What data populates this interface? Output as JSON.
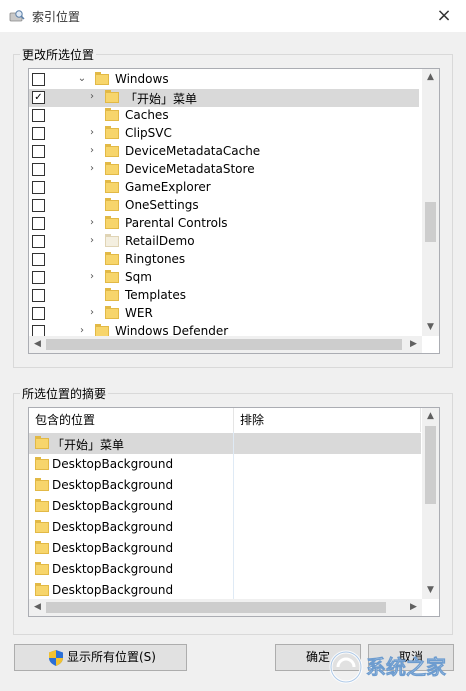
{
  "window": {
    "title": "索引位置",
    "close_icon": "×",
    "app_icon": "search-index-icon"
  },
  "change_group": {
    "legend": "更改所选位置",
    "tree": [
      {
        "label": "Windows",
        "checked": false,
        "expander": "down",
        "level": 0,
        "selected": false,
        "pale": false
      },
      {
        "label": "「开始」菜单",
        "checked": true,
        "expander": "right",
        "level": 1,
        "selected": true,
        "pale": false
      },
      {
        "label": "Caches",
        "checked": false,
        "expander": "none",
        "level": 1,
        "selected": false,
        "pale": false
      },
      {
        "label": "ClipSVC",
        "checked": false,
        "expander": "right",
        "level": 1,
        "selected": false,
        "pale": false
      },
      {
        "label": "DeviceMetadataCache",
        "checked": false,
        "expander": "right",
        "level": 1,
        "selected": false,
        "pale": false
      },
      {
        "label": "DeviceMetadataStore",
        "checked": false,
        "expander": "right",
        "level": 1,
        "selected": false,
        "pale": false
      },
      {
        "label": "GameExplorer",
        "checked": false,
        "expander": "none",
        "level": 1,
        "selected": false,
        "pale": false
      },
      {
        "label": "OneSettings",
        "checked": false,
        "expander": "none",
        "level": 1,
        "selected": false,
        "pale": false
      },
      {
        "label": "Parental Controls",
        "checked": false,
        "expander": "right",
        "level": 1,
        "selected": false,
        "pale": false
      },
      {
        "label": "RetailDemo",
        "checked": false,
        "expander": "right",
        "level": 1,
        "selected": false,
        "pale": true
      },
      {
        "label": "Ringtones",
        "checked": false,
        "expander": "none",
        "level": 1,
        "selected": false,
        "pale": false
      },
      {
        "label": "Sqm",
        "checked": false,
        "expander": "right",
        "level": 1,
        "selected": false,
        "pale": false
      },
      {
        "label": "Templates",
        "checked": false,
        "expander": "none",
        "level": 1,
        "selected": false,
        "pale": false
      },
      {
        "label": "WER",
        "checked": false,
        "expander": "right",
        "level": 1,
        "selected": false,
        "pale": false
      },
      {
        "label": "Windows Defender",
        "checked": false,
        "expander": "right",
        "level": 0,
        "selected": false,
        "pale": false
      }
    ]
  },
  "summary_group": {
    "legend": "所选位置的摘要",
    "columns": {
      "included": "包含的位置",
      "excluded": "排除"
    },
    "rows": [
      {
        "included": "「开始」菜单",
        "excluded": "",
        "selected": true
      },
      {
        "included": "DesktopBackground",
        "excluded": "",
        "selected": false
      },
      {
        "included": "DesktopBackground",
        "excluded": "",
        "selected": false
      },
      {
        "included": "DesktopBackground",
        "excluded": "",
        "selected": false
      },
      {
        "included": "DesktopBackground",
        "excluded": "",
        "selected": false
      },
      {
        "included": "DesktopBackground",
        "excluded": "",
        "selected": false
      },
      {
        "included": "DesktopBackground",
        "excluded": "",
        "selected": false
      },
      {
        "included": "DesktopBackground",
        "excluded": "",
        "selected": false
      }
    ]
  },
  "buttons": {
    "show_all": "显示所有位置(S)",
    "ok": "确定",
    "cancel": "取消"
  },
  "watermark": "系统之家",
  "colors": {
    "folder": "#f7d56b",
    "selection": "#d9d9d9",
    "shield_blue": "#2a6fd6",
    "shield_yellow": "#f2c12e"
  }
}
